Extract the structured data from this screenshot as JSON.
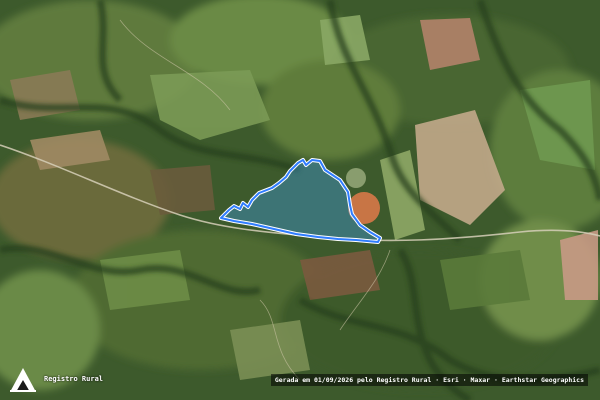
{
  "map": {
    "basemap": "satellite-imagery",
    "colors": {
      "parcel_outline": "#2f7dff",
      "parcel_fill": "#3fa7ff",
      "road": "#d6cfb8",
      "pivot_circle": "#e07a4a"
    }
  },
  "branding": {
    "logo_icon": "registro-rural-logo-icon",
    "logo_label": "Registro Rural"
  },
  "attribution": {
    "text": "Gerada em 01/09/2026 pelo Registro Rural · Esri · Maxar · Earthstar Geographics"
  }
}
